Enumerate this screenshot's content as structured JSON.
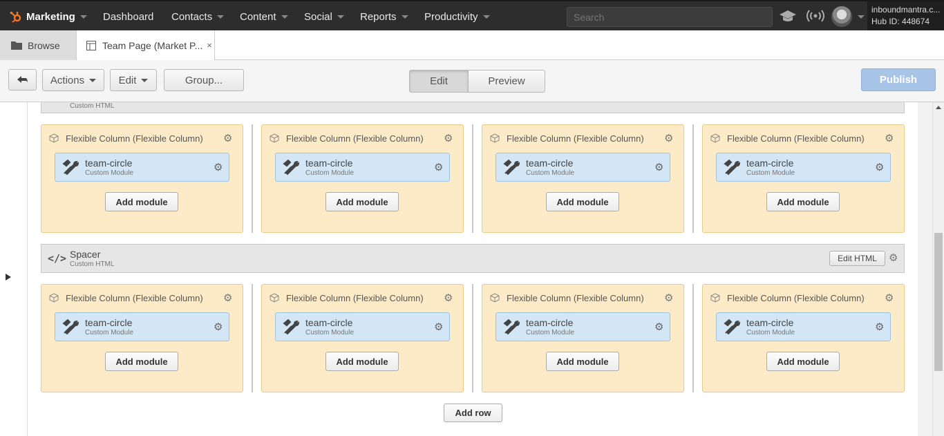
{
  "nav": {
    "brand": "Marketing",
    "items": [
      "Dashboard",
      "Contacts",
      "Content",
      "Social",
      "Reports",
      "Productivity"
    ],
    "search_placeholder": "Search",
    "account_name": "inboundmantra.c...",
    "hub_id": "Hub ID: 448674"
  },
  "tabs": {
    "browse": "Browse",
    "page": "Team Page (Market P...",
    "close": "×"
  },
  "toolbar": {
    "actions": "Actions",
    "edit": "Edit",
    "group": "Group...",
    "mode_edit": "Edit",
    "mode_preview": "Preview",
    "publish": "Publish"
  },
  "top_partial": {
    "subtitle": "Custom HTML"
  },
  "spacer": {
    "title": "Spacer",
    "subtitle": "Custom HTML",
    "edit_html": "Edit HTML"
  },
  "column": {
    "title": "Flexible Column (Flexible Column)",
    "module_name": "team-circle",
    "module_type": "Custom Module",
    "add_module": "Add module"
  },
  "add_row": "Add row",
  "colors": {
    "nav_bg": "#2d2d2d",
    "column_bg": "#fdebc8",
    "module_bg": "#d3e6f5",
    "publish_bg": "#a8c4e6"
  }
}
